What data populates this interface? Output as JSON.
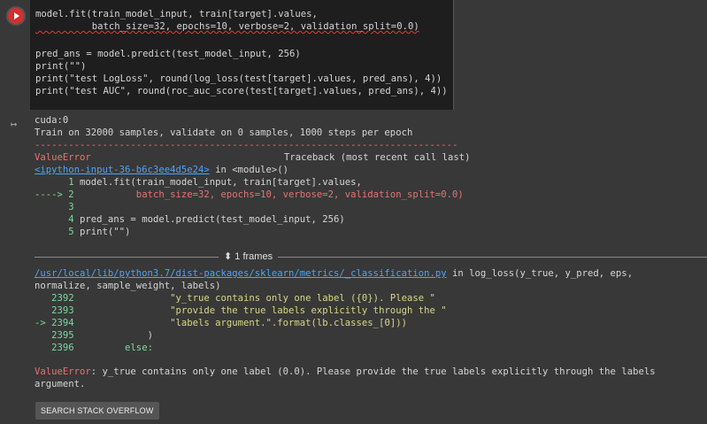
{
  "cell": {
    "code_lines": [
      "model.fit(train_model_input, train[target].values,",
      "          batch_size=32, epochs=10, verbose=2, validation_split=0.0)",
      "",
      "pred_ans = model.predict(test_model_input, 256)",
      "print(\"\")",
      "print(\"test LogLoss\", round(log_loss(test[target].values, pred_ans), 4))",
      "print(\"test AUC\", round(roc_auc_score(test[target].values, pred_ans), 4))"
    ]
  },
  "output": {
    "device": "cuda:0",
    "train_info": "Train on 32000 samples, validate on 0 samples, 1000 steps per epoch",
    "dashes": "---------------------------------------------------------------------------",
    "error_name": "ValueError",
    "traceback_header": "Traceback (most recent call last)",
    "input_link": "<ipython-input-36-b6c3ee4d5e24>",
    "in_module": " in <module>()",
    "tb_lines": [
      {
        "prefix": "      1 ",
        "text": "model.fit(train_model_input, train[target].values,"
      },
      {
        "prefix": "----> 2 ",
        "text": "          batch_size=32, epochs=10, verbose=2, validation_split=0.0)"
      },
      {
        "prefix": "      3 ",
        "text": ""
      },
      {
        "prefix": "      4 ",
        "text": "pred_ans = model.predict(test_model_input, 256)"
      },
      {
        "prefix": "      5 ",
        "text": "print(\"\")"
      }
    ],
    "frames_label": "1 frames",
    "lib_link": "/usr/local/lib/python3.7/dist-packages/sklearn/metrics/_classification.py",
    "lib_in": " in log_loss(y_true, y_pred, eps,",
    "lib_cont": "normalize, sample_weight, labels)",
    "lib_lines": [
      {
        "prefix": "   2392 ",
        "text": "                \"y_true contains only one label ({0}). Please \""
      },
      {
        "prefix": "   2393 ",
        "text": "                \"provide the true labels explicitly through the \""
      },
      {
        "prefix": "-> 2394 ",
        "text": "                \"labels argument.\".format(lb.classes_[0]))"
      },
      {
        "prefix": "   2395 ",
        "text": "            )"
      },
      {
        "prefix": "   2396 ",
        "text": "        else:"
      }
    ],
    "final_error_name": "ValueError",
    "final_error_msg": ": y_true contains only one label (0.0). Please provide the true labels explicitly through the labels",
    "final_error_cont": "argument."
  },
  "buttons": {
    "search_stack_overflow": "SEARCH STACK OVERFLOW"
  }
}
